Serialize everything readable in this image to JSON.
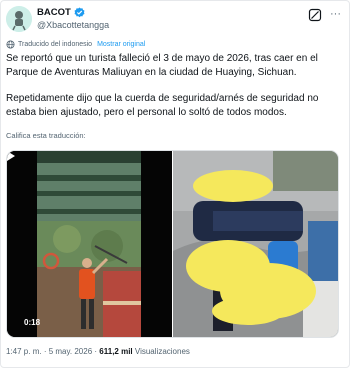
{
  "author": {
    "display_name": "BACOT",
    "handle": "@Xbacottetangga",
    "avatar_icon": "avatar-icon",
    "verified_color": "#1d9bf0"
  },
  "actions": {
    "grok_icon": "grok-icon",
    "more_label": "···"
  },
  "translation": {
    "notice": "Traducido del indonesio",
    "show_original": "Mostrar original",
    "rate": "Califica esta traducción:"
  },
  "tweet": {
    "paragraph_1": "Se reportó que un turista falleció el 3 de mayo de 2026, tras caer en el Parque de Aventuras Maliuyan en la ciudad de Huaying, Sichuan.",
    "paragraph_2": "Repetidamente dijo que la cuerda de seguridad/arnés de seguridad no estaba bien ajustado, pero el personal lo soltó de todos modos."
  },
  "media": {
    "video_time": "0:18",
    "play_icon": "play-icon",
    "image_redacted_color": "#f5e85c"
  },
  "meta": {
    "time": "1:47 p. m.",
    "separator": "·",
    "date": "5 may. 2026",
    "views_count": "611,2 mil",
    "views_label": "Visualizaciones"
  }
}
